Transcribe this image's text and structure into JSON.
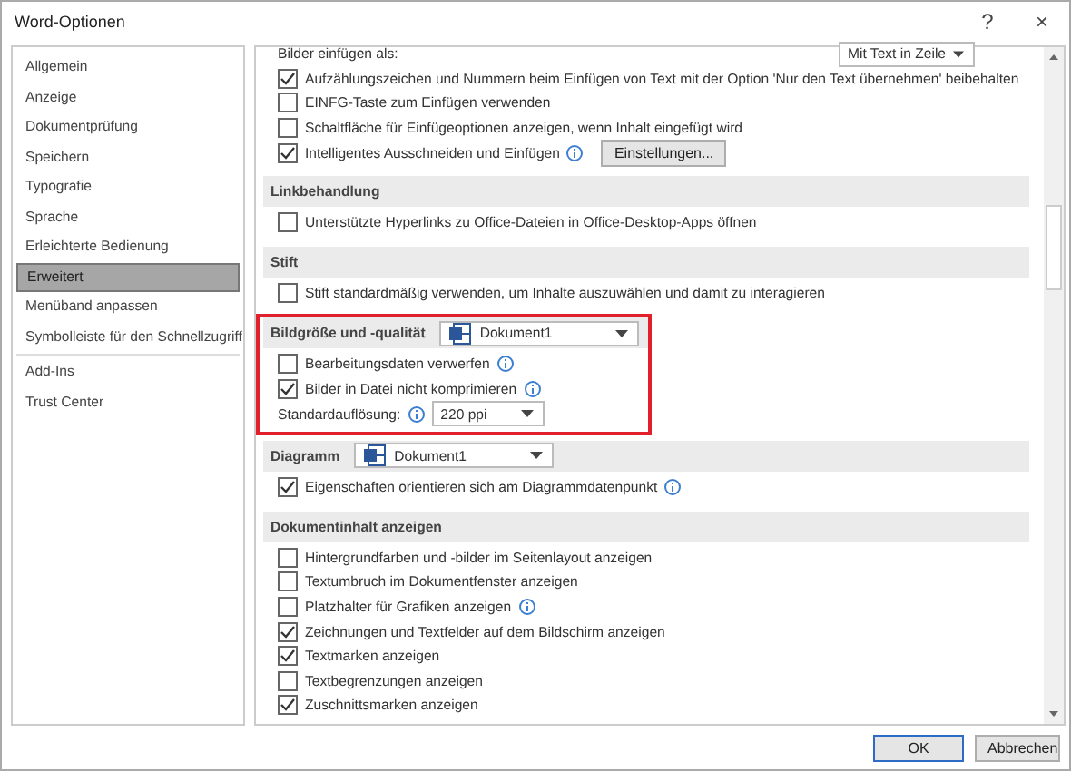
{
  "window": {
    "title": "Word-Optionen",
    "help": "?",
    "close": "×"
  },
  "sidebar": {
    "items": [
      {
        "label": "Allgemein",
        "selected": false,
        "divider_after": false
      },
      {
        "label": "Anzeige",
        "selected": false,
        "divider_after": false
      },
      {
        "label": "Dokumentprüfung",
        "selected": false,
        "divider_after": false
      },
      {
        "label": "Speichern",
        "selected": false,
        "divider_after": false
      },
      {
        "label": "Typografie",
        "selected": false,
        "divider_after": false
      },
      {
        "label": "Sprache",
        "selected": false,
        "divider_after": false
      },
      {
        "label": "Erleichterte Bedienung",
        "selected": false,
        "divider_after": false
      },
      {
        "label": "Erweitert",
        "selected": true,
        "divider_after": false
      },
      {
        "label": "Menüband anpassen",
        "selected": false,
        "divider_after": false
      },
      {
        "label": "Symbolleiste für den Schnellzugriff",
        "selected": false,
        "divider_after": true
      },
      {
        "label": "Add-Ins",
        "selected": false,
        "divider_after": false
      },
      {
        "label": "Trust Center",
        "selected": false,
        "divider_after": false
      }
    ]
  },
  "sections": [
    {
      "highlighted": false,
      "rows": [
        {
          "kind": "select",
          "label": "Bilder einfügen als:",
          "value": "Mit Text in Zeile",
          "info": false
        },
        {
          "kind": "checkbox",
          "label": "Aufzählungszeichen und Nummern beim Einfügen von Text mit der Option 'Nur den Text übernehmen' beibehalten",
          "checked": true,
          "info": false
        },
        {
          "kind": "checkbox",
          "label": "EINFG-Taste zum Einfügen verwenden",
          "checked": false,
          "info": false
        },
        {
          "kind": "checkbox",
          "label": "Schaltfläche für Einfügeoptionen anzeigen, wenn Inhalt eingefügt wird",
          "checked": false,
          "info": false
        },
        {
          "kind": "checkbox",
          "label": "Intelligentes Ausschneiden und Einfügen",
          "checked": true,
          "info": true,
          "button": "Einstellungen..."
        }
      ]
    },
    {
      "title": "Linkbehandlung",
      "highlighted": false,
      "rows": [
        {
          "kind": "checkbox",
          "label": "Unterstützte Hyperlinks zu Office-Dateien in Office-Desktop-Apps öffnen",
          "checked": false,
          "info": false
        }
      ]
    },
    {
      "title": "Stift",
      "highlighted": false,
      "rows": [
        {
          "kind": "checkbox",
          "label": "Stift standardmäßig verwenden, um Inhalte auszuwählen und damit zu interagieren",
          "checked": false,
          "info": false
        }
      ]
    },
    {
      "title": "Bildgröße und -qualität",
      "document": "Dokument1",
      "highlighted": true,
      "rows": [
        {
          "kind": "checkbox",
          "label": "Bearbeitungsdaten verwerfen",
          "checked": false,
          "info": true
        },
        {
          "kind": "checkbox",
          "label": "Bilder in Datei nicht komprimieren",
          "checked": true,
          "info": true
        },
        {
          "kind": "resolution",
          "label": "Standardauflösung:",
          "value": "220 ppi",
          "info": true
        }
      ]
    },
    {
      "title": "Diagramm",
      "document": "Dokument1",
      "highlighted": false,
      "rows": [
        {
          "kind": "checkbox",
          "label": "Eigenschaften orientieren sich am Diagrammdatenpunkt",
          "checked": true,
          "info": true
        }
      ]
    },
    {
      "title": "Dokumentinhalt anzeigen",
      "highlighted": false,
      "rows": [
        {
          "kind": "checkbox",
          "label": "Hintergrundfarben und -bilder im Seitenlayout anzeigen",
          "checked": false,
          "info": false
        },
        {
          "kind": "checkbox",
          "label": "Textumbruch im Dokumentfenster anzeigen",
          "checked": false,
          "info": false
        },
        {
          "kind": "checkbox",
          "label": "Platzhalter für Grafiken anzeigen",
          "checked": false,
          "info": true
        },
        {
          "kind": "checkbox",
          "label": "Zeichnungen und Textfelder auf dem Bildschirm anzeigen",
          "checked": true,
          "info": false
        },
        {
          "kind": "checkbox",
          "label": "Textmarken anzeigen",
          "checked": true,
          "info": false
        },
        {
          "kind": "checkbox",
          "label": "Textbegrenzungen anzeigen",
          "checked": false,
          "info": false
        },
        {
          "kind": "checkbox",
          "label": "Zuschnittsmarken anzeigen",
          "checked": true,
          "info": false
        }
      ]
    }
  ],
  "buttons": [
    {
      "label": "OK",
      "default": true
    },
    {
      "label": "Abbrechen",
      "default": false
    }
  ]
}
